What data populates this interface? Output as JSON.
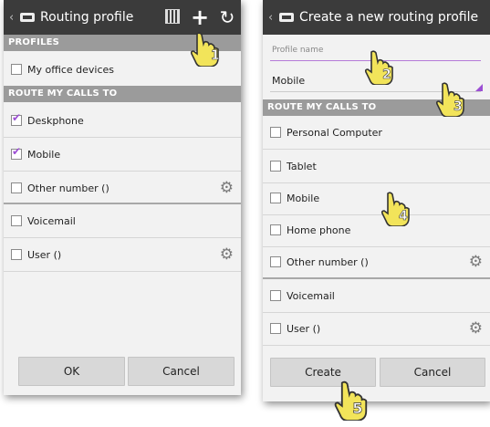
{
  "left_screen": {
    "title": "Routing profile",
    "back_glyph": "‹",
    "icons": [
      "qr-code-icon",
      "add-icon",
      "refresh-icon"
    ],
    "profiles_header": "PROFILES",
    "profiles": [
      {
        "label": "My office devices",
        "checked": false
      }
    ],
    "route_header": "ROUTE MY CALLS TO",
    "route_items": [
      {
        "label": "Deskphone",
        "checked": true
      },
      {
        "label": "Mobile",
        "checked": true
      },
      {
        "label": "Other number ()",
        "checked": false,
        "gear": true
      },
      {
        "label": "Voicemail",
        "checked": false
      },
      {
        "label": "User ()",
        "checked": false,
        "gear": true
      }
    ],
    "ok_label": "OK",
    "cancel_label": "Cancel",
    "callout": "1"
  },
  "right_screen": {
    "title": "Create a new routing profile",
    "back_glyph": "‹",
    "name_placeholder": "Profile name",
    "selected_device": "Mobile",
    "route_header": "ROUTE MY CALLS TO",
    "route_items": [
      {
        "label": "Personal Computer",
        "checked": false
      },
      {
        "label": "Tablet",
        "checked": false
      },
      {
        "label": "Mobile",
        "checked": false
      },
      {
        "label": "Home phone",
        "checked": false
      },
      {
        "label": "Other number ()",
        "checked": false,
        "gear": true
      },
      {
        "label": "Voicemail",
        "checked": false
      },
      {
        "label": "User ()",
        "checked": false,
        "gear": true
      }
    ],
    "create_label": "Create",
    "cancel_label": "Cancel",
    "callouts": [
      "2",
      "3",
      "4",
      "5"
    ]
  },
  "colors": {
    "actionbar": "#3b3b3b",
    "section": "#9b9b9b",
    "accent": "#9c4fd4",
    "callout": "#f2e45a"
  }
}
